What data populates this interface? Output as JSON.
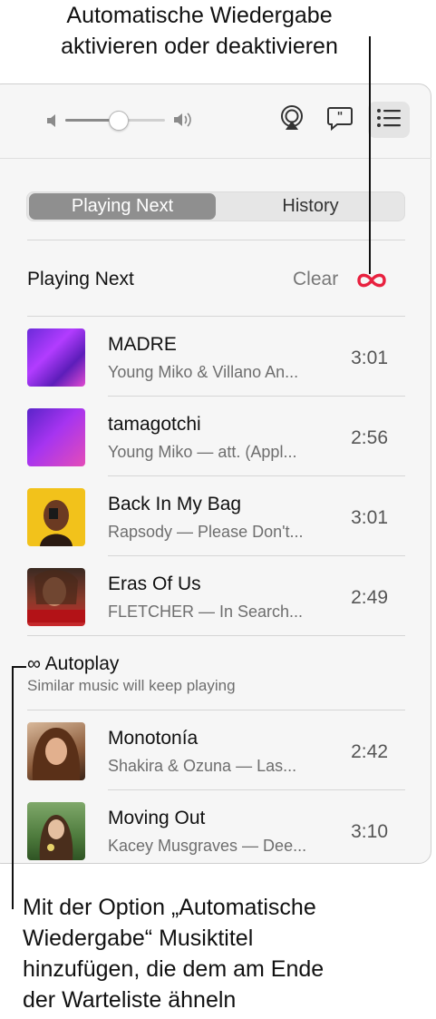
{
  "callouts": {
    "top": [
      "Automatische Wiedergabe",
      "aktivieren oder deaktivieren"
    ],
    "bottom": [
      "Mit der Option „Automatische",
      "Wiedergabe“ Musiktitel",
      "hinzufügen, die dem am Ende",
      "der Warteliste ähneln"
    ]
  },
  "toolbar": {
    "volume_level": 0.55,
    "icons": [
      "volume-low-icon",
      "volume-high-icon",
      "airplay-icon",
      "lyrics-icon",
      "queue-list-icon"
    ]
  },
  "tabs": {
    "active": "Playing Next",
    "inactive": "History"
  },
  "queue": {
    "title": "Playing Next",
    "clear_label": "Clear",
    "autoplay_symbol": "∞",
    "tracks": [
      {
        "title": "MADRE",
        "subtitle": "Young Miko & Villano An...",
        "duration": "3:01"
      },
      {
        "title": "tamagotchi",
        "subtitle": "Young Miko — att. (Appl...",
        "duration": "2:56"
      },
      {
        "title": "Back In My Bag",
        "subtitle": "Rapsody — Please Don't...",
        "duration": "3:01"
      },
      {
        "title": "Eras Of Us",
        "subtitle": "FLETCHER — In Search...",
        "duration": "2:49"
      }
    ]
  },
  "autoplay": {
    "symbol": "∞",
    "title": "Autoplay",
    "subtitle": "Similar music will keep playing",
    "tracks": [
      {
        "title": "Monotonía",
        "subtitle": "Shakira & Ozuna — Las...",
        "duration": "2:42"
      },
      {
        "title": "Moving Out",
        "subtitle": "Kacey Musgraves — Dee...",
        "duration": "3:10"
      }
    ]
  },
  "colors": {
    "accent": "#e8213f",
    "segment_active": "#8f8f8f"
  }
}
